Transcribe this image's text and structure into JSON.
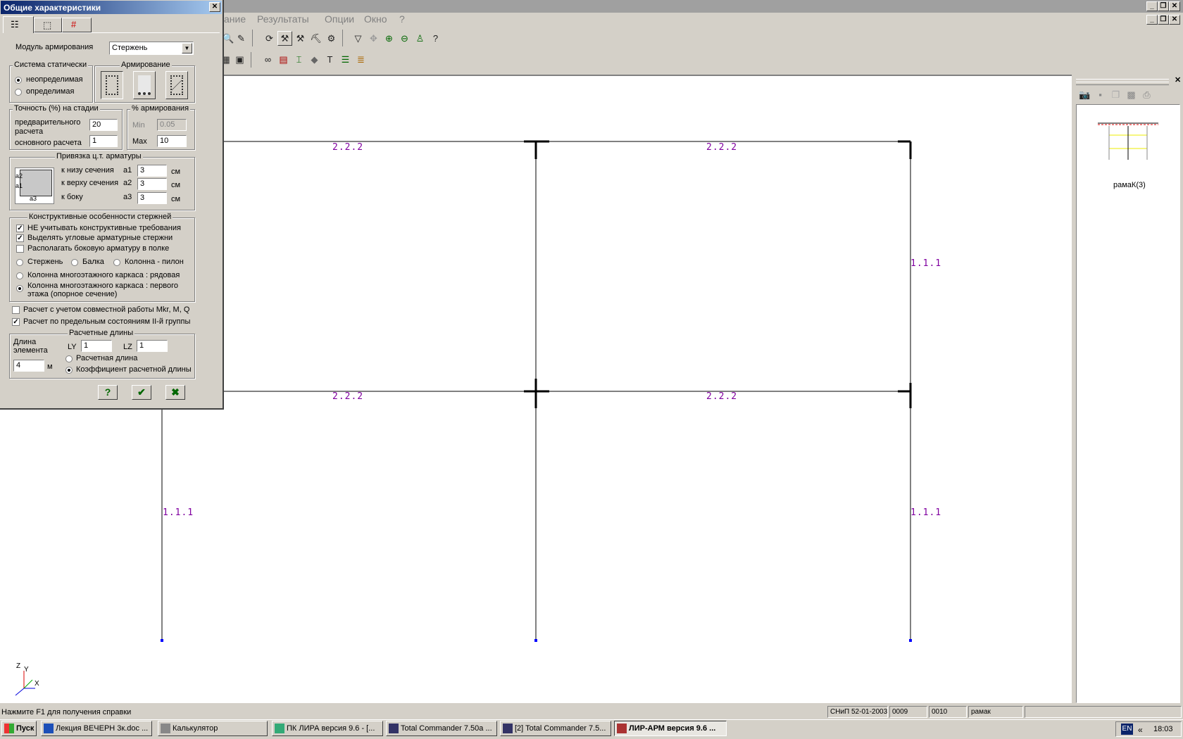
{
  "menu": [
    "ание",
    "Результаты",
    "Опции",
    "Окно",
    "?"
  ],
  "dialog": {
    "title": "Общие характеристики",
    "module_label": "Модуль армирования",
    "module_value": "Стержень",
    "static_group": "Система статически",
    "static_opt1": "неопределимая",
    "static_opt2": "определимая",
    "arm_group": "Армирование",
    "accuracy_group": "Точность (%) на стадии",
    "prelim_label1": "предварительного",
    "prelim_label2": "расчета",
    "prelim_value": "20",
    "main_label": "основного расчета",
    "main_value": "1",
    "pct_group": "% армирования",
    "min_label": "Min",
    "min_value": "0.05",
    "max_label": "Max",
    "max_value": "10",
    "bind_group": "Привязка  ц.т. арматуры",
    "bottom_label": "к низу сечения",
    "a1": "a1",
    "a1_value": "3",
    "top_label": "к верху сечения",
    "a2": "a2",
    "a2_value": "3",
    "side_label": "к боку",
    "a3": "a3",
    "a3_value": "3",
    "unit_cm": "см",
    "sec_a2": "a2",
    "sec_a1": "a1",
    "sec_a3": "a3",
    "constr_group": "Конструктивные особенности стержней",
    "chk1": "НЕ учитывать конструктивные требования",
    "chk2": "Выделять угловые арматурные стержни",
    "chk3": "Располагать боковую арматуру в полке",
    "r_rod": "Стержень",
    "r_beam": "Балка",
    "r_column": "Колонна - пилон",
    "r_frame_row": "Колонна многоэтажного каркаса : рядовая",
    "r_frame_first1": "Колонна многоэтажного каркаса : первого",
    "r_frame_first2": "этажа (опорное сечение)",
    "chk_joint": "Расчет с учетом совместной работы Mkr, M, Q",
    "chk_limit": "Расчет по предельным состояниям II-й группы",
    "len_group": "Расчетные длины",
    "elem_len1": "Длина",
    "elem_len2": "элемента",
    "elem_len_value": "4",
    "unit_m": "м",
    "ly_label": "LY",
    "ly_value": "1",
    "lz_label": "LZ",
    "lz_value": "1",
    "r_calc_len": "Расчетная длина",
    "r_coef_len": "Коэффициент расчетной длины"
  },
  "canvas": {
    "beam_label": "2.2.2",
    "column_label": "1.1.1",
    "axis_z": "Z",
    "axis_y": "Y",
    "axis_x": "X"
  },
  "preview": {
    "caption": "рамаК(3)"
  },
  "statusbar": {
    "hint": "Нажмите F1 для получения справки",
    "norm": "СНиП 52-01-2003",
    "c1": "0009",
    "c2": "0010",
    "c3": "рамак"
  },
  "taskbar": {
    "start": "Пуск",
    "items": [
      "Лекция ВЕЧЕРН 3к.doc ...",
      "Калькулятор",
      "ПК ЛИРА  версия 9.6 - [...",
      "Total Commander 7.50a ...",
      "[2] Total Commander 7.5...",
      "ЛИР-АРМ версия 9.6  ..."
    ],
    "lang": "EN",
    "clock": "18:03"
  },
  "colors": {
    "titlebar": "#0a246a",
    "label_purple": "#8000a0",
    "desktop": "#d4d0c8"
  }
}
